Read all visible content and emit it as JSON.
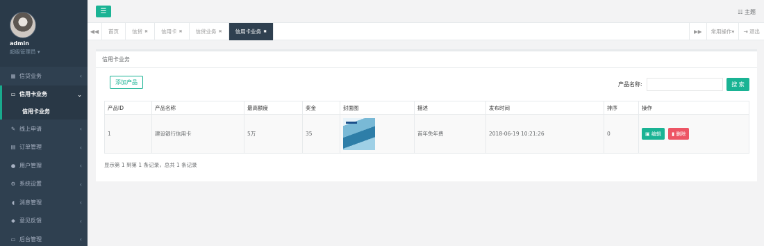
{
  "user": {
    "name": "admin",
    "role": "超级管理员 ▾"
  },
  "sidebar": {
    "items": [
      {
        "label": "信贷业务",
        "icon": "calendar-icon"
      },
      {
        "label": "信用卡业务",
        "icon": "credit-card-icon",
        "active": true
      },
      {
        "label": "线上申请",
        "icon": "edit-icon"
      },
      {
        "label": "订单管理",
        "icon": "list-icon"
      },
      {
        "label": "用户管理",
        "icon": "user-icon"
      },
      {
        "label": "系统设置",
        "icon": "cogs-icon"
      },
      {
        "label": "消息管理",
        "icon": "comment-icon"
      },
      {
        "label": "意见反馈",
        "icon": "tag-icon"
      },
      {
        "label": "后台管理",
        "icon": "desktop-icon"
      }
    ],
    "submenu": "信用卡业务"
  },
  "topbar": {
    "theme_label": "主题"
  },
  "tabs": [
    {
      "label": "首页"
    },
    {
      "label": "信贷"
    },
    {
      "label": "信用卡"
    },
    {
      "label": "信贷业务"
    },
    {
      "label": "信用卡业务",
      "active": true
    }
  ],
  "tab_right": {
    "ops_label": "常用操作▾",
    "logout_label": "退出"
  },
  "panel": {
    "title": "信用卡业务",
    "add_button": "添加产品",
    "search_label": "产品名称:",
    "search_value": "",
    "search_button": "搜 索"
  },
  "table": {
    "headers": [
      "产品ID",
      "产品名称",
      "最高额度",
      "奖金",
      "封面图",
      "描述",
      "发布时间",
      "排序",
      "操作"
    ],
    "rows": [
      {
        "id": "1",
        "name": "建设银行信用卡",
        "limit": "5万",
        "bonus": "35",
        "desc": "首年免年费",
        "time": "2018-06-19 10:21:26",
        "sort": "0"
      }
    ],
    "edit_label": "编辑",
    "delete_label": "删除"
  },
  "footer": "显示第 1 到第 1 条记录，总共 1 条记录",
  "colors": {
    "primary": "#1ab394",
    "danger": "#ed5565",
    "sidebar": "#2f4050"
  }
}
